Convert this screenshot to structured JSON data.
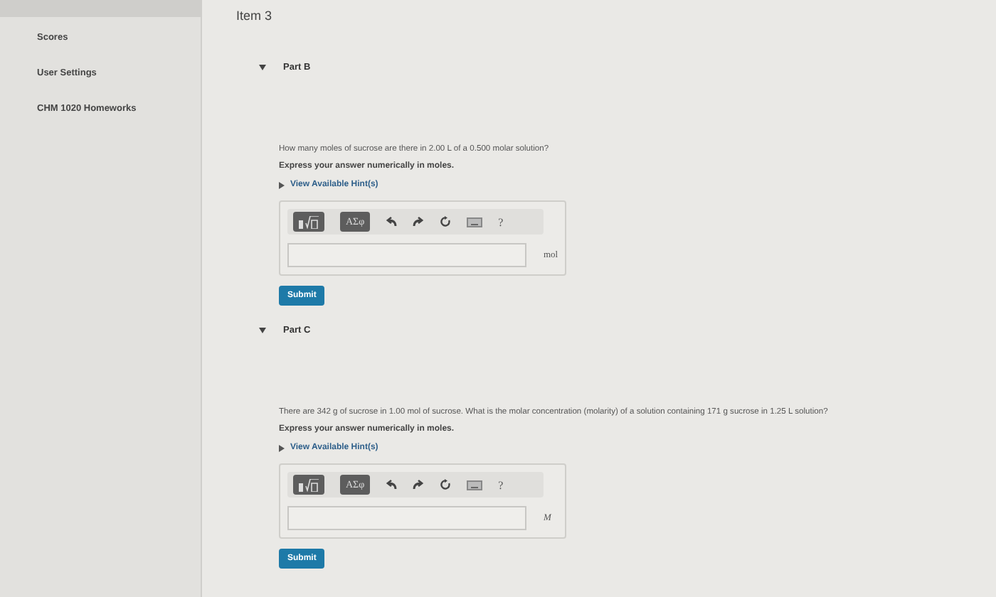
{
  "sidebar": {
    "items": [
      {
        "label": "Scores"
      },
      {
        "label": "User Settings"
      },
      {
        "label": "CHM 1020 Homeworks"
      }
    ]
  },
  "item_title": "Item 3",
  "parts": [
    {
      "title": "Part B",
      "expanded": true,
      "question": "How many moles of sucrose are there in 2.00 L of a 0.500 molar solution?",
      "instruction": "Express your answer numerically in moles.",
      "hint_link": "View Available Hint(s)",
      "toolbar": {
        "greek": "ΑΣφ",
        "help": "?"
      },
      "unit": "mol",
      "unit_italic": false,
      "submit": "Submit"
    },
    {
      "title": "Part C",
      "expanded": true,
      "question": "There are 342 g of sucrose in 1.00 mol of sucrose. What is the molar concentration (molarity) of a solution containing 171 g sucrose in 1.25 L solution?",
      "instruction": "Express your answer numerically in moles.",
      "hint_link": "View Available Hint(s)",
      "toolbar": {
        "greek": "ΑΣφ",
        "help": "?"
      },
      "unit": "M",
      "unit_italic": true,
      "submit": "Submit"
    }
  ]
}
